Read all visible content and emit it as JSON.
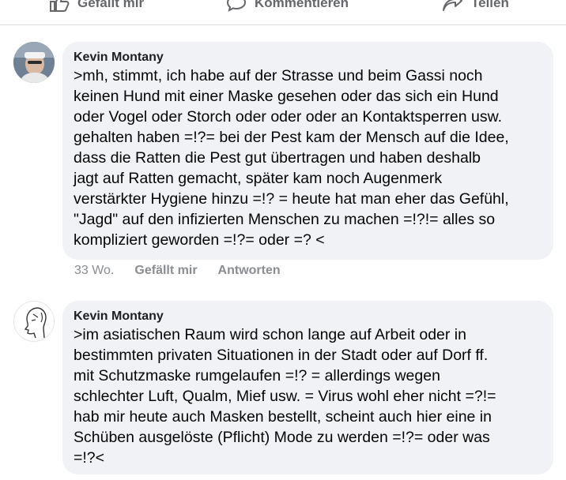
{
  "actions": {
    "like": "Gefällt mir",
    "comment": "Kommentieren",
    "share": "Teilen"
  },
  "comments": [
    {
      "author": "Kevin Montany",
      "lines": [
        ">mh, stimmt, ich habe auf der Strasse und beim Gassi noch",
        "keinen Hund mit einer Maske gesehen oder das sich ein Hund",
        "oder Vogel oder Storch  oder oder  oder an Kontaktsperren usw.",
        "gehalten haben =!?= bei der Pest kam der Mensch auf die Idee,",
        "dass die Ratten  die  Pest gut übertragen und haben deshalb",
        "jagt auf Ratten gemacht, später kam noch Augenmerk",
        "verstärkter Hygiene hinzu =!? = heute hat man eher das Gefühl,",
        "\"Jagd\" auf den infizierten  Menschen zu machen =!?!= alles so",
        "kompliziert geworden =!?= oder =? <"
      ],
      "time": "33 Wo.",
      "like": "Gefällt mir",
      "reply": "Antworten"
    },
    {
      "author": "Kevin Montany",
      "lines": [
        ">im asiatischen Raum wird schon lange auf Arbeit oder in",
        "bestimmten privaten Situationen in der Stadt oder auf Dorf  ff.",
        "mit Schutzmaske rumgelaufen =!? = allerdings wegen",
        "schlechter Luft, Qualm, Mief usw. = Virus wohl eher nicht =?!=",
        "hab mir heute auch Masken bestellt, scheint auch hier  eine in",
        "Schüben ausgelöste (Pflicht) Mode  zu werden =!?= oder was",
        "=!?<"
      ]
    }
  ]
}
